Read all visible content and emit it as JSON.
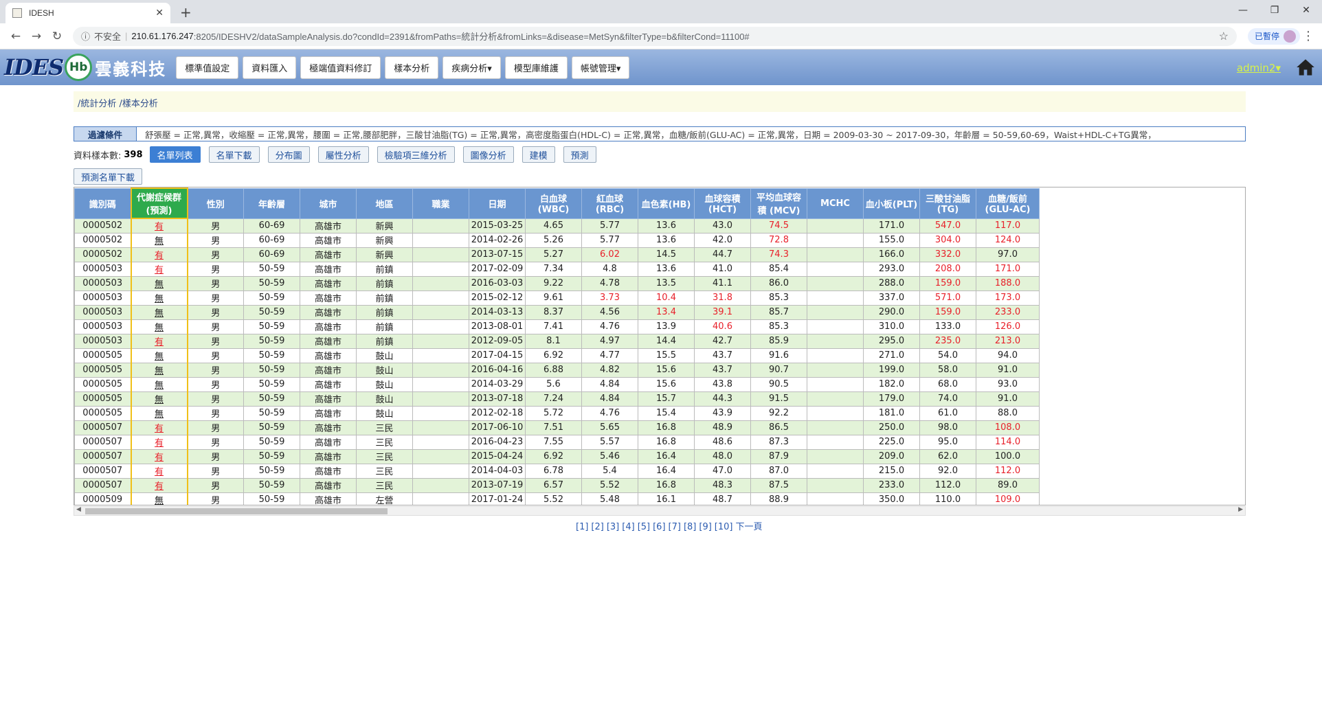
{
  "browser": {
    "tab_title": "IDESH",
    "insecure_label": "不安全",
    "url_host": "210.61.176.247",
    "url_path": ":8205/IDESHV2/dataSampleAnalysis.do?condId=2391&fromPaths=統計分析&fromLinks=&disease=MetSyn&filterType=b&filterCond=11100#",
    "paused_label": "已暫停"
  },
  "app": {
    "logo_text": "IDES",
    "logo_mark": "Hb",
    "brand": "雲義科技",
    "nav": [
      "標準值設定",
      "資料匯入",
      "極端值資料修訂",
      "樣本分析",
      "疾病分析▾",
      "模型庫維護",
      "帳號管理▾"
    ],
    "user": "admin2▾"
  },
  "breadcrumb": "/統計分析 /樣本分析",
  "filter": {
    "label": "過濾條件",
    "value": "舒張壓 = 正常,異常，收縮壓 = 正常,異常，腰圍 = 正常,腰部肥胖，三酸甘油脂(TG) = 正常,異常，高密度脂蛋白(HDL-C) = 正常,異常，血糖/飯前(GLU-AC) = 正常,異常，日期 = 2009-03-30 ~ 2017-09-30，年齡層 = 50-59,60-69，Waist+HDL-C+TG異常，"
  },
  "controls": {
    "count_label": "資料樣本數:",
    "count": "398",
    "buttons": [
      "名單列表",
      "名單下載",
      "分布圖",
      "屬性分析",
      "檢驗項三維分析",
      "圖像分析",
      "建模",
      "預測"
    ],
    "predict_download": "預測名單下載"
  },
  "table": {
    "headers": [
      "識別碼",
      "代謝症候群 (預測)",
      "性別",
      "年齡層",
      "城市",
      "地區",
      "職業",
      "日期",
      "白血球(WBC)",
      "紅血球(RBC)",
      "血色素(HB)",
      "血球容積(HCT)",
      "平均血球容積 (MCV)",
      "MCHC",
      "血小板(PLT)",
      "三酸甘油脂(TG)",
      "血糖/飯前(GLU-AC)"
    ],
    "rows": [
      [
        "0000502",
        "有",
        "男",
        "60-69",
        "高雄市",
        "新興",
        "",
        "2015-03-25",
        "4.65",
        "5.77",
        "13.6",
        "43.0",
        "74.5",
        "",
        "171.0",
        "547.0",
        "117.0"
      ],
      [
        "0000502",
        "無",
        "男",
        "60-69",
        "高雄市",
        "新興",
        "",
        "2014-02-26",
        "5.26",
        "5.77",
        "13.6",
        "42.0",
        "72.8",
        "",
        "155.0",
        "304.0",
        "124.0"
      ],
      [
        "0000502",
        "有",
        "男",
        "60-69",
        "高雄市",
        "新興",
        "",
        "2013-07-15",
        "5.27",
        "6.02",
        "14.5",
        "44.7",
        "74.3",
        "",
        "166.0",
        "332.0",
        "97.0"
      ],
      [
        "0000503",
        "有",
        "男",
        "50-59",
        "高雄市",
        "前鎮",
        "",
        "2017-02-09",
        "7.34",
        "4.8",
        "13.6",
        "41.0",
        "85.4",
        "",
        "293.0",
        "208.0",
        "171.0"
      ],
      [
        "0000503",
        "無",
        "男",
        "50-59",
        "高雄市",
        "前鎮",
        "",
        "2016-03-03",
        "9.22",
        "4.78",
        "13.5",
        "41.1",
        "86.0",
        "",
        "288.0",
        "159.0",
        "188.0"
      ],
      [
        "0000503",
        "無",
        "男",
        "50-59",
        "高雄市",
        "前鎮",
        "",
        "2015-02-12",
        "9.61",
        "3.73",
        "10.4",
        "31.8",
        "85.3",
        "",
        "337.0",
        "571.0",
        "173.0"
      ],
      [
        "0000503",
        "無",
        "男",
        "50-59",
        "高雄市",
        "前鎮",
        "",
        "2014-03-13",
        "8.37",
        "4.56",
        "13.4",
        "39.1",
        "85.7",
        "",
        "290.0",
        "159.0",
        "233.0"
      ],
      [
        "0000503",
        "無",
        "男",
        "50-59",
        "高雄市",
        "前鎮",
        "",
        "2013-08-01",
        "7.41",
        "4.76",
        "13.9",
        "40.6",
        "85.3",
        "",
        "310.0",
        "133.0",
        "126.0"
      ],
      [
        "0000503",
        "有",
        "男",
        "50-59",
        "高雄市",
        "前鎮",
        "",
        "2012-09-05",
        "8.1",
        "4.97",
        "14.4",
        "42.7",
        "85.9",
        "",
        "295.0",
        "235.0",
        "213.0"
      ],
      [
        "0000505",
        "無",
        "男",
        "50-59",
        "高雄市",
        "鼓山",
        "",
        "2017-04-15",
        "6.92",
        "4.77",
        "15.5",
        "43.7",
        "91.6",
        "",
        "271.0",
        "54.0",
        "94.0"
      ],
      [
        "0000505",
        "無",
        "男",
        "50-59",
        "高雄市",
        "鼓山",
        "",
        "2016-04-16",
        "6.88",
        "4.82",
        "15.6",
        "43.7",
        "90.7",
        "",
        "199.0",
        "58.0",
        "91.0"
      ],
      [
        "0000505",
        "無",
        "男",
        "50-59",
        "高雄市",
        "鼓山",
        "",
        "2014-03-29",
        "5.6",
        "4.84",
        "15.6",
        "43.8",
        "90.5",
        "",
        "182.0",
        "68.0",
        "93.0"
      ],
      [
        "0000505",
        "無",
        "男",
        "50-59",
        "高雄市",
        "鼓山",
        "",
        "2013-07-18",
        "7.24",
        "4.84",
        "15.7",
        "44.3",
        "91.5",
        "",
        "179.0",
        "74.0",
        "91.0"
      ],
      [
        "0000505",
        "無",
        "男",
        "50-59",
        "高雄市",
        "鼓山",
        "",
        "2012-02-18",
        "5.72",
        "4.76",
        "15.4",
        "43.9",
        "92.2",
        "",
        "181.0",
        "61.0",
        "88.0"
      ],
      [
        "0000507",
        "有",
        "男",
        "50-59",
        "高雄市",
        "三民",
        "",
        "2017-06-10",
        "7.51",
        "5.65",
        "16.8",
        "48.9",
        "86.5",
        "",
        "250.0",
        "98.0",
        "108.0"
      ],
      [
        "0000507",
        "有",
        "男",
        "50-59",
        "高雄市",
        "三民",
        "",
        "2016-04-23",
        "7.55",
        "5.57",
        "16.8",
        "48.6",
        "87.3",
        "",
        "225.0",
        "95.0",
        "114.0"
      ],
      [
        "0000507",
        "有",
        "男",
        "50-59",
        "高雄市",
        "三民",
        "",
        "2015-04-24",
        "6.92",
        "5.46",
        "16.4",
        "48.0",
        "87.9",
        "",
        "209.0",
        "62.0",
        "100.0"
      ],
      [
        "0000507",
        "有",
        "男",
        "50-59",
        "高雄市",
        "三民",
        "",
        "2014-04-03",
        "6.78",
        "5.4",
        "16.4",
        "47.0",
        "87.0",
        "",
        "215.0",
        "92.0",
        "112.0"
      ],
      [
        "0000507",
        "有",
        "男",
        "50-59",
        "高雄市",
        "三民",
        "",
        "2013-07-19",
        "6.57",
        "5.52",
        "16.8",
        "48.3",
        "87.5",
        "",
        "233.0",
        "112.0",
        "89.0"
      ],
      [
        "0000509",
        "無",
        "男",
        "50-59",
        "高雄市",
        "左營",
        "",
        "2017-01-24",
        "5.52",
        "5.48",
        "16.1",
        "48.7",
        "88.9",
        "",
        "350.0",
        "110.0",
        "109.0"
      ]
    ],
    "red_cells": [
      [
        0,
        12
      ],
      [
        0,
        15
      ],
      [
        0,
        16
      ],
      [
        1,
        12
      ],
      [
        1,
        15
      ],
      [
        1,
        16
      ],
      [
        2,
        9
      ],
      [
        2,
        12
      ],
      [
        2,
        15
      ],
      [
        3,
        15
      ],
      [
        3,
        16
      ],
      [
        4,
        15
      ],
      [
        4,
        16
      ],
      [
        5,
        9
      ],
      [
        5,
        10
      ],
      [
        5,
        11
      ],
      [
        5,
        15
      ],
      [
        5,
        16
      ],
      [
        6,
        10
      ],
      [
        6,
        11
      ],
      [
        6,
        15
      ],
      [
        6,
        16
      ],
      [
        7,
        11
      ],
      [
        7,
        16
      ],
      [
        8,
        15
      ],
      [
        8,
        16
      ],
      [
        14,
        16
      ],
      [
        15,
        16
      ],
      [
        17,
        16
      ],
      [
        19,
        16
      ]
    ]
  },
  "pager": {
    "pages": [
      "[1]",
      "[2]",
      "[3]",
      "[4]",
      "[5]",
      "[6]",
      "[7]",
      "[8]",
      "[9]",
      "[10]"
    ],
    "next": "下一頁"
  },
  "colors": {
    "header_bg": "#6a96d0",
    "row_alt": "#e3f3d8",
    "selected_col": "#2eaa4c",
    "abnormal": "#e8202a"
  }
}
